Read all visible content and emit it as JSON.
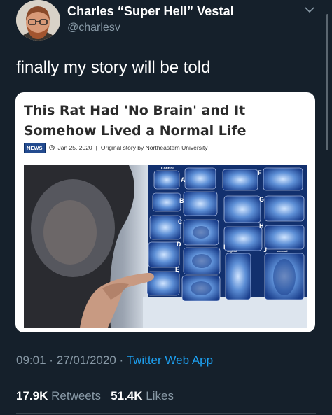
{
  "author": {
    "name": "Charles “Super Hell” Vestal",
    "handle": "@charlesv"
  },
  "tweet": {
    "text": "finally my story will be told"
  },
  "article": {
    "headline": "This Rat Had 'No Brain' and It Somehow Lived a Normal Life",
    "badge": "NEWS",
    "date": "Jan 25, 2020",
    "separator": "|",
    "source": "Original story by Northeastern University"
  },
  "scan_labels": {
    "control": "Control",
    "letters": [
      "A",
      "B",
      "C",
      "D",
      "E",
      "F",
      "G",
      "H",
      "I",
      "J"
    ],
    "sagittal": "sagittal",
    "coronal": "coronal"
  },
  "footer": {
    "time": "09:01",
    "dot": "·",
    "date": "27/01/2020",
    "app": "Twitter Web App",
    "retweets_count": "17.9K",
    "retweets_label": "Retweets",
    "likes_count": "51.4K",
    "likes_label": "Likes"
  },
  "colors": {
    "background": "#15202b",
    "secondary_text": "#8899a6",
    "link": "#1da1f2",
    "badge": "#234b8f"
  }
}
